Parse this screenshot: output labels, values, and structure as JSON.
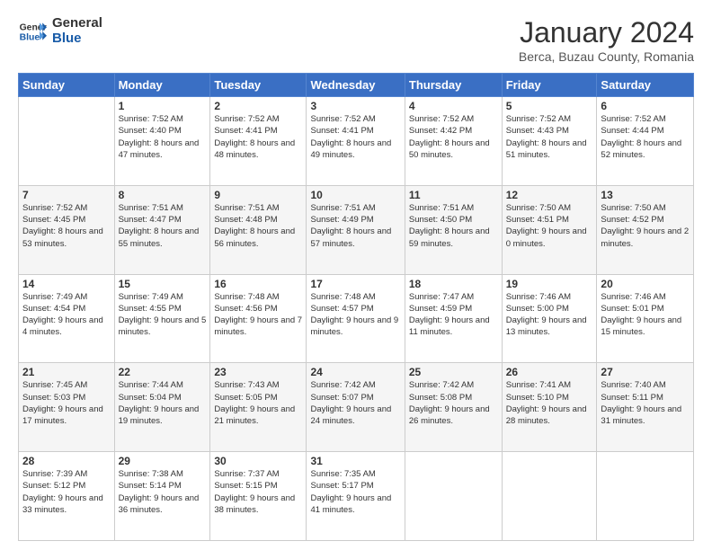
{
  "header": {
    "logo_line1": "General",
    "logo_line2": "Blue",
    "month": "January 2024",
    "location": "Berca, Buzau County, Romania"
  },
  "weekdays": [
    "Sunday",
    "Monday",
    "Tuesday",
    "Wednesday",
    "Thursday",
    "Friday",
    "Saturday"
  ],
  "weeks": [
    [
      {
        "day": "",
        "sunrise": "",
        "sunset": "",
        "daylight": ""
      },
      {
        "day": "1",
        "sunrise": "Sunrise: 7:52 AM",
        "sunset": "Sunset: 4:40 PM",
        "daylight": "Daylight: 8 hours and 47 minutes."
      },
      {
        "day": "2",
        "sunrise": "Sunrise: 7:52 AM",
        "sunset": "Sunset: 4:41 PM",
        "daylight": "Daylight: 8 hours and 48 minutes."
      },
      {
        "day": "3",
        "sunrise": "Sunrise: 7:52 AM",
        "sunset": "Sunset: 4:41 PM",
        "daylight": "Daylight: 8 hours and 49 minutes."
      },
      {
        "day": "4",
        "sunrise": "Sunrise: 7:52 AM",
        "sunset": "Sunset: 4:42 PM",
        "daylight": "Daylight: 8 hours and 50 minutes."
      },
      {
        "day": "5",
        "sunrise": "Sunrise: 7:52 AM",
        "sunset": "Sunset: 4:43 PM",
        "daylight": "Daylight: 8 hours and 51 minutes."
      },
      {
        "day": "6",
        "sunrise": "Sunrise: 7:52 AM",
        "sunset": "Sunset: 4:44 PM",
        "daylight": "Daylight: 8 hours and 52 minutes."
      }
    ],
    [
      {
        "day": "7",
        "sunrise": "Sunrise: 7:52 AM",
        "sunset": "Sunset: 4:45 PM",
        "daylight": "Daylight: 8 hours and 53 minutes."
      },
      {
        "day": "8",
        "sunrise": "Sunrise: 7:51 AM",
        "sunset": "Sunset: 4:47 PM",
        "daylight": "Daylight: 8 hours and 55 minutes."
      },
      {
        "day": "9",
        "sunrise": "Sunrise: 7:51 AM",
        "sunset": "Sunset: 4:48 PM",
        "daylight": "Daylight: 8 hours and 56 minutes."
      },
      {
        "day": "10",
        "sunrise": "Sunrise: 7:51 AM",
        "sunset": "Sunset: 4:49 PM",
        "daylight": "Daylight: 8 hours and 57 minutes."
      },
      {
        "day": "11",
        "sunrise": "Sunrise: 7:51 AM",
        "sunset": "Sunset: 4:50 PM",
        "daylight": "Daylight: 8 hours and 59 minutes."
      },
      {
        "day": "12",
        "sunrise": "Sunrise: 7:50 AM",
        "sunset": "Sunset: 4:51 PM",
        "daylight": "Daylight: 9 hours and 0 minutes."
      },
      {
        "day": "13",
        "sunrise": "Sunrise: 7:50 AM",
        "sunset": "Sunset: 4:52 PM",
        "daylight": "Daylight: 9 hours and 2 minutes."
      }
    ],
    [
      {
        "day": "14",
        "sunrise": "Sunrise: 7:49 AM",
        "sunset": "Sunset: 4:54 PM",
        "daylight": "Daylight: 9 hours and 4 minutes."
      },
      {
        "day": "15",
        "sunrise": "Sunrise: 7:49 AM",
        "sunset": "Sunset: 4:55 PM",
        "daylight": "Daylight: 9 hours and 5 minutes."
      },
      {
        "day": "16",
        "sunrise": "Sunrise: 7:48 AM",
        "sunset": "Sunset: 4:56 PM",
        "daylight": "Daylight: 9 hours and 7 minutes."
      },
      {
        "day": "17",
        "sunrise": "Sunrise: 7:48 AM",
        "sunset": "Sunset: 4:57 PM",
        "daylight": "Daylight: 9 hours and 9 minutes."
      },
      {
        "day": "18",
        "sunrise": "Sunrise: 7:47 AM",
        "sunset": "Sunset: 4:59 PM",
        "daylight": "Daylight: 9 hours and 11 minutes."
      },
      {
        "day": "19",
        "sunrise": "Sunrise: 7:46 AM",
        "sunset": "Sunset: 5:00 PM",
        "daylight": "Daylight: 9 hours and 13 minutes."
      },
      {
        "day": "20",
        "sunrise": "Sunrise: 7:46 AM",
        "sunset": "Sunset: 5:01 PM",
        "daylight": "Daylight: 9 hours and 15 minutes."
      }
    ],
    [
      {
        "day": "21",
        "sunrise": "Sunrise: 7:45 AM",
        "sunset": "Sunset: 5:03 PM",
        "daylight": "Daylight: 9 hours and 17 minutes."
      },
      {
        "day": "22",
        "sunrise": "Sunrise: 7:44 AM",
        "sunset": "Sunset: 5:04 PM",
        "daylight": "Daylight: 9 hours and 19 minutes."
      },
      {
        "day": "23",
        "sunrise": "Sunrise: 7:43 AM",
        "sunset": "Sunset: 5:05 PM",
        "daylight": "Daylight: 9 hours and 21 minutes."
      },
      {
        "day": "24",
        "sunrise": "Sunrise: 7:42 AM",
        "sunset": "Sunset: 5:07 PM",
        "daylight": "Daylight: 9 hours and 24 minutes."
      },
      {
        "day": "25",
        "sunrise": "Sunrise: 7:42 AM",
        "sunset": "Sunset: 5:08 PM",
        "daylight": "Daylight: 9 hours and 26 minutes."
      },
      {
        "day": "26",
        "sunrise": "Sunrise: 7:41 AM",
        "sunset": "Sunset: 5:10 PM",
        "daylight": "Daylight: 9 hours and 28 minutes."
      },
      {
        "day": "27",
        "sunrise": "Sunrise: 7:40 AM",
        "sunset": "Sunset: 5:11 PM",
        "daylight": "Daylight: 9 hours and 31 minutes."
      }
    ],
    [
      {
        "day": "28",
        "sunrise": "Sunrise: 7:39 AM",
        "sunset": "Sunset: 5:12 PM",
        "daylight": "Daylight: 9 hours and 33 minutes."
      },
      {
        "day": "29",
        "sunrise": "Sunrise: 7:38 AM",
        "sunset": "Sunset: 5:14 PM",
        "daylight": "Daylight: 9 hours and 36 minutes."
      },
      {
        "day": "30",
        "sunrise": "Sunrise: 7:37 AM",
        "sunset": "Sunset: 5:15 PM",
        "daylight": "Daylight: 9 hours and 38 minutes."
      },
      {
        "day": "31",
        "sunrise": "Sunrise: 7:35 AM",
        "sunset": "Sunset: 5:17 PM",
        "daylight": "Daylight: 9 hours and 41 minutes."
      },
      {
        "day": "",
        "sunrise": "",
        "sunset": "",
        "daylight": ""
      },
      {
        "day": "",
        "sunrise": "",
        "sunset": "",
        "daylight": ""
      },
      {
        "day": "",
        "sunrise": "",
        "sunset": "",
        "daylight": ""
      }
    ]
  ]
}
